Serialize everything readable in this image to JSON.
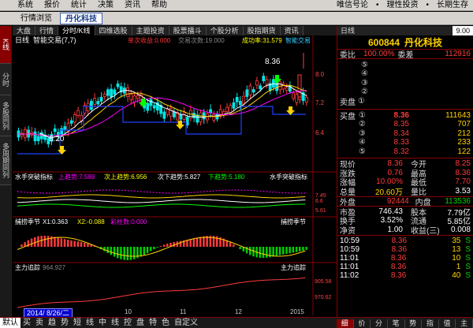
{
  "menu": {
    "items": [
      "系统",
      "报价",
      "统计",
      "决策",
      "资讯",
      "帮助"
    ],
    "slogans": [
      "唯信号论",
      "理性投资",
      "长期生存"
    ]
  },
  "tabs2": [
    "行情浏览",
    "丹化科技"
  ],
  "vtabs": [
    "K线",
    "分时",
    "多股同列",
    "多周期同列"
  ],
  "ctabs": [
    "大盘",
    "行情",
    "分时/K线",
    "四维选股",
    "主题投资",
    "股票擂斗",
    "个股分析",
    "股指期货",
    "资讯"
  ],
  "kline": {
    "title": "日线",
    "indicator": "智能交易(7,7)",
    "ind_values": [
      "单次收益:0.000",
      "交易次数:19.000",
      "成功率:31.579",
      "智能交易"
    ],
    "high_label": "8.36",
    "low_label": "6.20",
    "axis_ticks": [
      "9.00",
      "8.0",
      "7.2",
      "6.4"
    ]
  },
  "sub1": {
    "name": "水手突破指标",
    "up": "上趋势:7.589",
    "mid": "次上趋势:6.956",
    "sub": "次下趋势:5.827",
    "down": "下趋势:5.180",
    "right": "水手突破指标",
    "ticks": [
      "7.45",
      "6.6",
      "5.61"
    ]
  },
  "sub2": {
    "name": "捕捞季节",
    "x1": "X1:0.363",
    "x2": "X2:-0.088",
    "bar": "彩柱数:0.000",
    "right": "捕捞季节"
  },
  "sub3": {
    "name": "主力追踪",
    "val": "964.927",
    "right": "主力追踪",
    "ticks": [
      "905.58",
      "970.62"
    ]
  },
  "date_cursor": "2014/ 8/26/二",
  "date_axis": [
    "10",
    "11",
    "12",
    "2015"
  ],
  "quote": {
    "hdr": [
      "日线",
      "9.00"
    ],
    "code": "600844",
    "name": "丹化科技",
    "weibi_label": "委比",
    "weibi": "100.00%",
    "weicha_label": "委差",
    "weicha": "112916",
    "sell_label": "卖盘",
    "buy_label": "买盘",
    "sells": [
      "⑤",
      "④",
      "③",
      "②",
      "①"
    ],
    "buys": [
      {
        "n": "①",
        "p": "8.36",
        "v": "111643"
      },
      {
        "n": "②",
        "p": "8.35",
        "v": "707"
      },
      {
        "n": "③",
        "p": "8.34",
        "v": "212"
      },
      {
        "n": "④",
        "p": "8.33",
        "v": "233"
      },
      {
        "n": "⑤",
        "p": "8.32",
        "v": "122"
      }
    ],
    "stats": [
      {
        "l1": "现价",
        "v1": "8.36",
        "c1": "red",
        "l2": "今开",
        "v2": "8.25",
        "c2": "red"
      },
      {
        "l1": "涨跌",
        "v1": "0.76",
        "c1": "red",
        "l2": "最高",
        "v2": "8.36",
        "c2": "red"
      },
      {
        "l1": "涨幅",
        "v1": "10.00%",
        "c1": "red",
        "l2": "最低",
        "v2": "7.70",
        "c2": "red"
      },
      {
        "l1": "总量",
        "v1": "20.60万",
        "c1": "yellow",
        "l2": "量比",
        "v2": "3.53",
        "c2": "white"
      }
    ],
    "outin": {
      "l1": "外盘",
      "v1": "92444",
      "l2": "内盘",
      "v2": "113536"
    },
    "fund": [
      {
        "l1": "市盈",
        "v1": "746.43",
        "l2": "股本",
        "v2": "7.79亿"
      },
      {
        "l1": "换手",
        "v1": "3.52%",
        "l2": "流通",
        "v2": "5.85亿"
      },
      {
        "l1": "净资",
        "v1": "1.00",
        "l2": "收益(三)",
        "v2": "0.008"
      }
    ],
    "ticks": [
      {
        "t": "10:59",
        "p": "8.36",
        "v": "35",
        "s": "S"
      },
      {
        "t": "10:59",
        "p": "8.36",
        "v": "13",
        "s": "S"
      },
      {
        "t": "11:01",
        "p": "8.36",
        "v": "10",
        "s": "S"
      },
      {
        "t": "11:01",
        "p": "8.36",
        "v": "1",
        "s": "S"
      },
      {
        "t": "11:02",
        "p": "8.36",
        "v": "40",
        "s": "S"
      }
    ]
  },
  "bottom": [
    "默认",
    "买",
    "卖",
    "趋",
    "势",
    "短",
    "线",
    "中",
    "线",
    "控",
    "盘",
    "特",
    "色",
    "自定义"
  ],
  "rtabs": [
    "细",
    "价",
    "分",
    "笔",
    "势",
    "指",
    "值",
    "主"
  ]
}
